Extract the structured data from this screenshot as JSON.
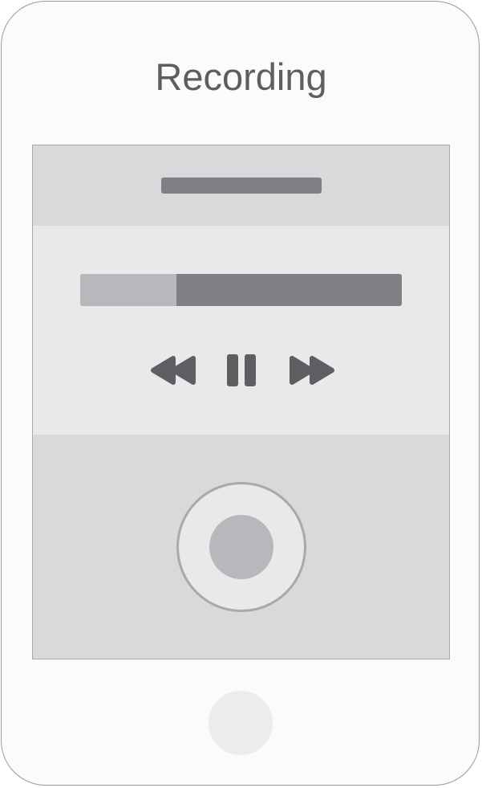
{
  "header": {
    "title": "Recording"
  },
  "player": {
    "progress_fraction": 0.3,
    "controls": [
      {
        "name": "rewind-button",
        "icon": "rewind-icon"
      },
      {
        "name": "pause-button",
        "icon": "pause-icon"
      },
      {
        "name": "fast-forward-button",
        "icon": "fast-forward-icon"
      }
    ]
  },
  "recorder": {
    "icon": "record-icon"
  },
  "device": {
    "home_icon": "home-button-icon"
  },
  "colors": {
    "frame_bg": "#fbfafc",
    "panel_light": "#e9e9ea",
    "panel_mid": "#d9d9db",
    "accent_dark": "#5f5e62",
    "bar_dark": "#817f85",
    "bar_light": "#b8b7bc"
  }
}
